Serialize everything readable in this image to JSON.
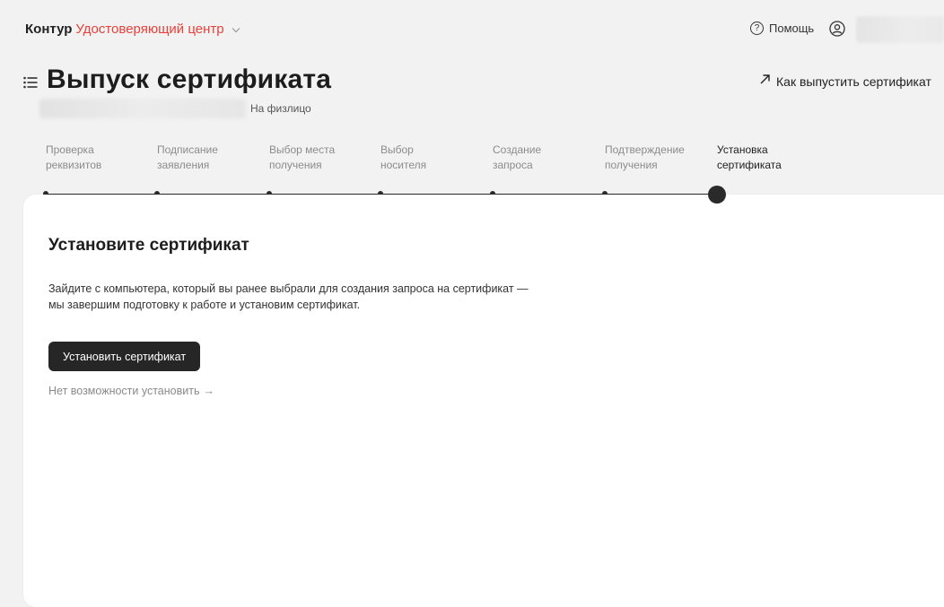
{
  "header": {
    "brand_name": "Контур",
    "brand_product": "Удостоверяющий центр",
    "help_label": "Помощь",
    "page_title": "Выпуск сертификата",
    "subtitle": "На физлицо",
    "howto_link": "Как выпустить сертификат"
  },
  "steps": [
    {
      "line1": "Проверка",
      "line2": "реквизитов",
      "state": "done"
    },
    {
      "line1": "Подписание",
      "line2": "заявления",
      "state": "done"
    },
    {
      "line1": "Выбор места",
      "line2": "получения",
      "state": "done"
    },
    {
      "line1": "Выбор",
      "line2": "носителя",
      "state": "done"
    },
    {
      "line1": "Создание",
      "line2": "запроса",
      "state": "done"
    },
    {
      "line1": "Подтверждение",
      "line2": "получения",
      "state": "done"
    },
    {
      "line1": "Установка",
      "line2": "сертификата",
      "state": "active"
    }
  ],
  "card": {
    "title": "Установите сертификат",
    "text_line1": "Зайдите с компьютера, который вы ранее выбрали для создания запроса на сертификат —",
    "text_line2": "мы завершим подготовку к работе и установим сертификат.",
    "primary_button": "Установить сертификат",
    "secondary_link": "Нет возможности установить",
    "secondary_arrow": "→"
  },
  "colors": {
    "accent": "#e8413a",
    "dark": "#262626",
    "background": "#f2f2f2"
  },
  "icons": [
    "chevron-down-icon",
    "help-icon",
    "user-icon",
    "menu-icon",
    "arrow-up-right-icon",
    "arrow-right-icon"
  ]
}
